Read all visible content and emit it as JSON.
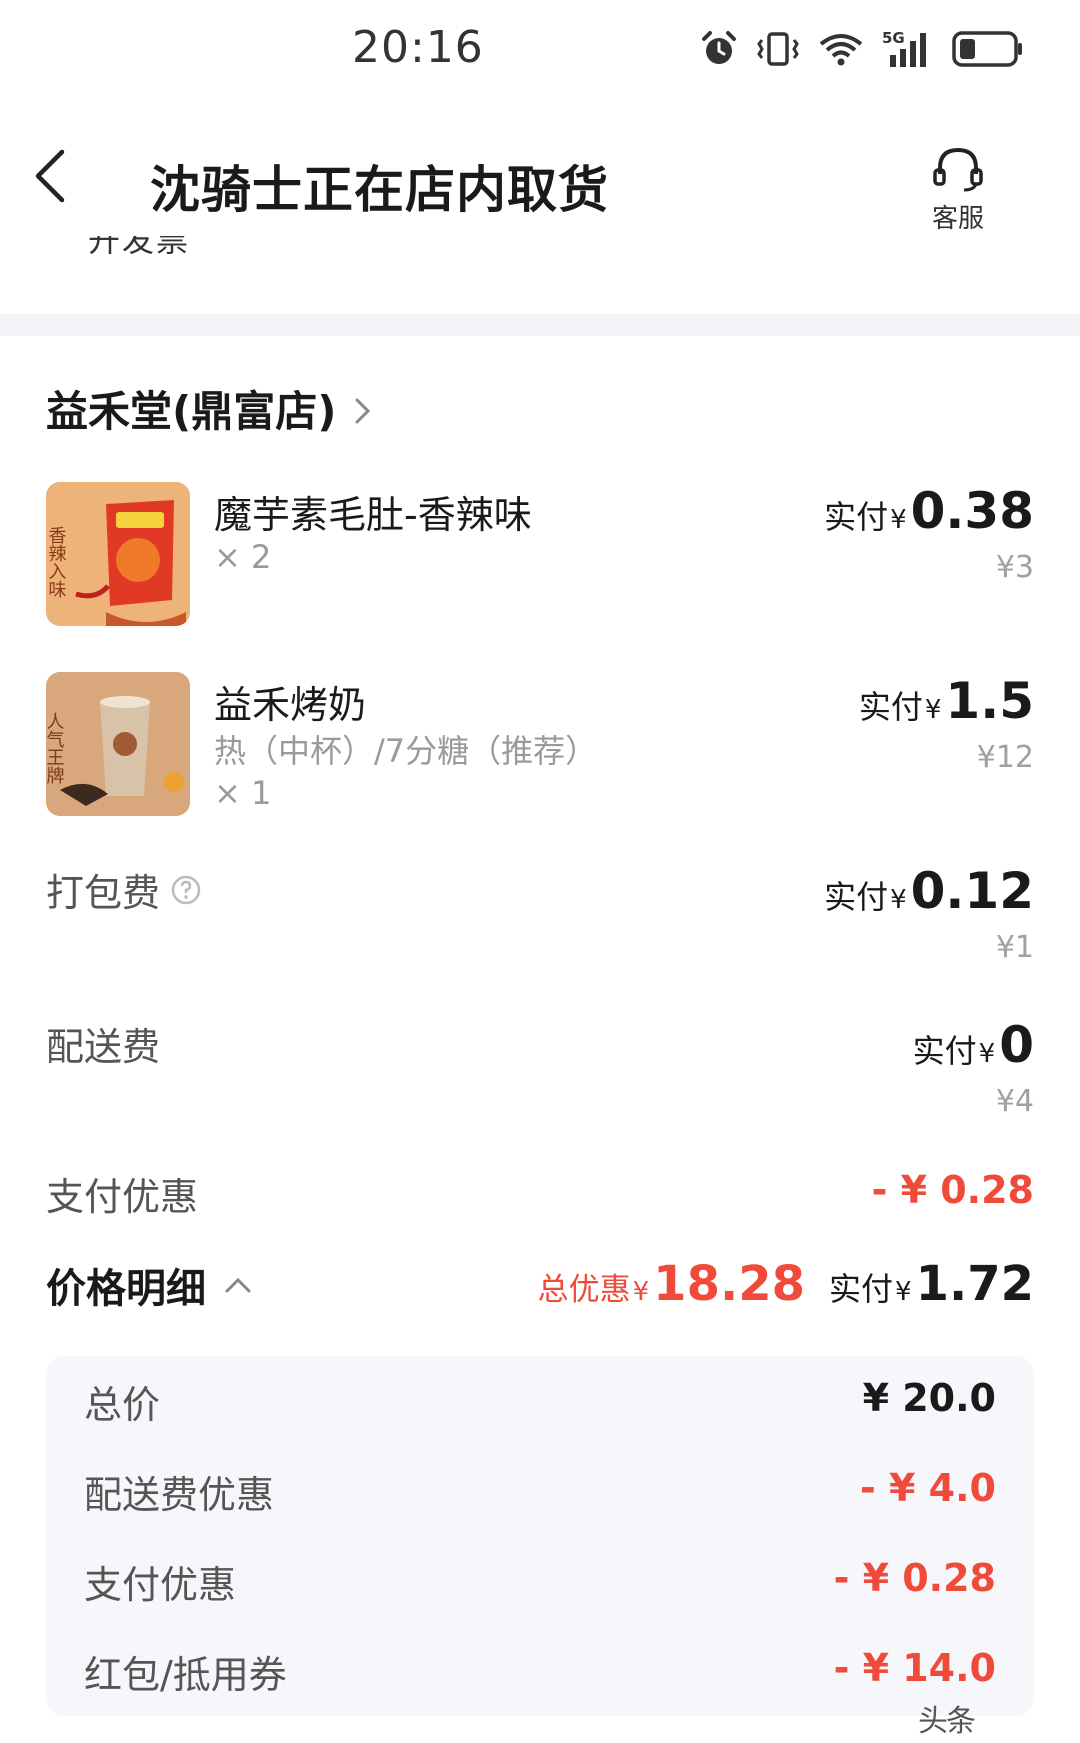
{
  "status_bar": {
    "time": "20:16",
    "icons": [
      "alarm-icon",
      "vibrate-icon",
      "wifi-icon",
      "5g-signal-icon",
      "battery-icon"
    ],
    "network": "5G",
    "battery_level": 0.3
  },
  "header": {
    "title": "沈骑士正在店内取货",
    "service_label": "客服",
    "invoice_partial": "开发票"
  },
  "store": {
    "name": "益禾堂(鼎富店)"
  },
  "items": [
    {
      "name": "魔芋素毛肚-香辣味",
      "spec": "",
      "qty": "× 2",
      "pay_prefix": "实付",
      "yen": "¥",
      "pay_amount": "0.38",
      "original_price": "¥3",
      "thumb_text": "香辣入味"
    },
    {
      "name": "益禾烤奶",
      "spec": "热（中杯）/7分糖（推荐）",
      "qty": "× 1",
      "pay_prefix": "实付",
      "yen": "¥",
      "pay_amount": "1.5",
      "original_price": "¥12",
      "thumb_text": "人气王牌"
    }
  ],
  "fees": [
    {
      "label": "打包费",
      "pay_prefix": "实付",
      "yen": "¥",
      "pay_amount": "0.12",
      "original_price": "¥1"
    },
    {
      "label": "配送费",
      "pay_prefix": "实付",
      "yen": "¥",
      "pay_amount": "0",
      "original_price": "¥4"
    }
  ],
  "payment_discount": {
    "label": "支付优惠",
    "amount": "- ¥ 0.28"
  },
  "price_detail": {
    "title": "价格明细",
    "total_discount_label": "总优惠",
    "total_discount_yen": "¥",
    "total_discount_amount": "18.28",
    "pay_prefix": "实付",
    "pay_yen": "¥",
    "pay_amount": "1.72"
  },
  "breakdown": [
    {
      "label": "总价",
      "value": "¥ 20.0"
    },
    {
      "label": "配送费优惠",
      "value": "- ¥ 4.0"
    },
    {
      "label": "支付优惠",
      "value": "- ¥ 0.28"
    },
    {
      "label": "红包/抵用券",
      "value": "- ¥ 14.0"
    }
  ],
  "colors": {
    "discount_red": "#f04a3a",
    "band_gray": "#f2f4f8",
    "panel_gray": "#f5f7fa"
  },
  "watermark": "头条"
}
